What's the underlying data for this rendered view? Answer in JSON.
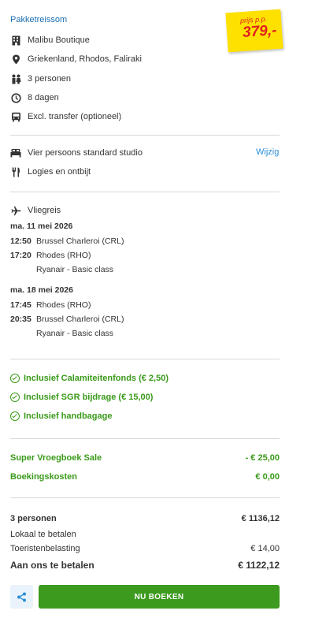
{
  "header": {
    "title": "Pakketreissom"
  },
  "price_tag": {
    "label": "prijs p.p.",
    "price": "379,-"
  },
  "details": [
    {
      "icon": "building-icon",
      "text": "Malibu Boutique"
    },
    {
      "icon": "location-pin-icon",
      "text": "Griekenland, Rhodos, Faliraki"
    },
    {
      "icon": "persons-icon",
      "text": "3 personen"
    },
    {
      "icon": "clock-icon",
      "text": "8 dagen"
    },
    {
      "icon": "bus-icon",
      "text": "Excl. transfer",
      "note": "(optioneel)"
    }
  ],
  "room": {
    "icon": "bed-icon",
    "text": "Vier persoons standard studio",
    "change_link": "Wijzig"
  },
  "board": {
    "icon": "cutlery-icon",
    "text": "Logies en ontbijt"
  },
  "flight": {
    "icon": "plane-icon",
    "title": "Vliegreis",
    "outbound": {
      "date": "ma. 11 mei 2026",
      "dep_time": "12:50",
      "dep_airport": "Brussel Charleroi (CRL)",
      "arr_time": "17:20",
      "arr_airport": "Rhodes (RHO)",
      "carrier": "Ryanair - Basic class"
    },
    "return": {
      "date": "ma. 18 mei 2026",
      "dep_time": "17:45",
      "dep_airport": "Rhodes (RHO)",
      "arr_time": "20:35",
      "arr_airport": "Brussel Charleroi (CRL)",
      "carrier": "Ryanair - Basic class"
    }
  },
  "inclusions": [
    "Inclusief Calamiteitenfonds (€ 2,50)",
    "Inclusief SGR bijdrage (€ 15,00)",
    "Inclusief handbagage"
  ],
  "discounts": [
    {
      "label": "Super Vroegboek Sale",
      "value": "- € 25,00"
    },
    {
      "label": "Boekingskosten",
      "value": "€ 0,00"
    }
  ],
  "summary": {
    "persons_label": "3 personen",
    "persons_total": "€ 1136,12",
    "local_label": "Lokaal te betalen",
    "tax_label": "Toeristenbelasting",
    "tax_value": "€ 14,00",
    "pay_label": "Aan ons te betalen",
    "pay_value": "€ 1122,12"
  },
  "actions": {
    "share_icon": "share-icon",
    "book_label": "NU BOEKEN"
  },
  "colors": {
    "accent_blue": "#1a6fb3",
    "green": "#3a9a1a",
    "cta_green": "#3c9a1e",
    "price_red": "#e02020",
    "sticker_yellow": "#ffe100"
  }
}
